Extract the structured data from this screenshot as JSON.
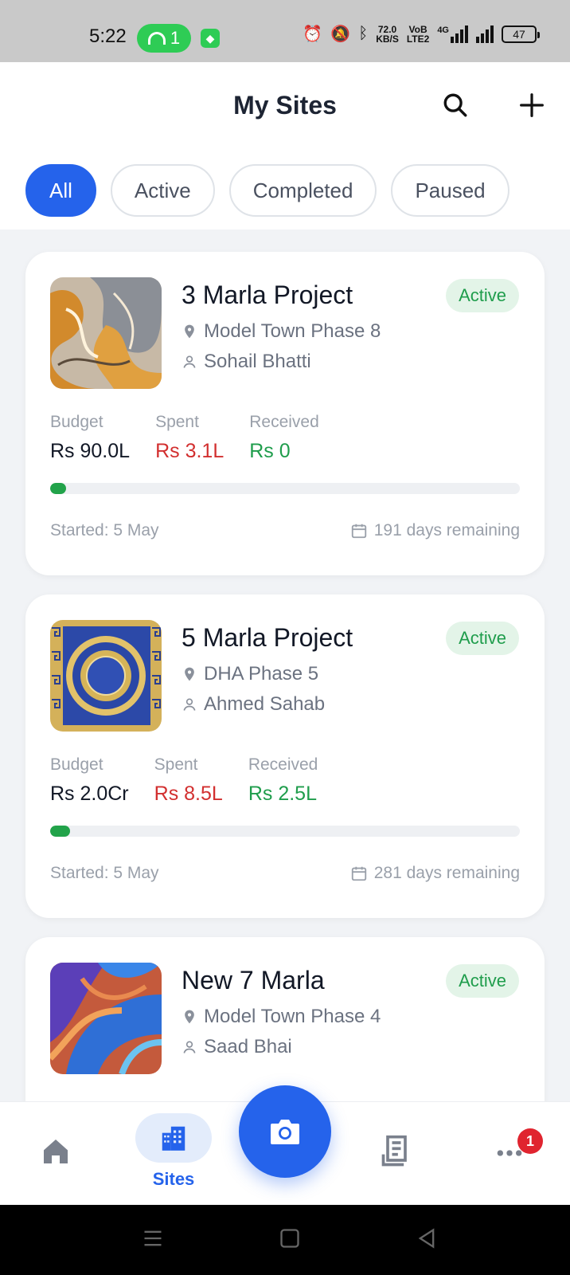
{
  "status_bar": {
    "time": "5:22",
    "hotspot_count": "1",
    "net_speed_value": "72.0",
    "net_speed_unit": "KB/S",
    "volte_top": "VoB",
    "volte_bottom": "LTE2",
    "network": "4G",
    "battery": "47"
  },
  "header": {
    "title": "My Sites",
    "search_icon": "search-icon",
    "add_icon": "plus-icon"
  },
  "filters": [
    {
      "label": "All",
      "selected": true
    },
    {
      "label": "Active",
      "selected": false
    },
    {
      "label": "Completed",
      "selected": false
    },
    {
      "label": "Paused",
      "selected": false
    }
  ],
  "stat_labels": {
    "budget": "Budget",
    "spent": "Spent",
    "received": "Received"
  },
  "sites": [
    {
      "name": "3 Marla Project",
      "status": "Active",
      "location": "Model Town Phase 8",
      "contact": "Sohail Bhatti",
      "budget": "Rs 90.0L",
      "spent": "Rs 3.1L",
      "received": "Rs 0",
      "progress": 0.034,
      "started": "Started: 5 May",
      "remaining": "191 days remaining"
    },
    {
      "name": "5 Marla Project",
      "status": "Active",
      "location": "DHA Phase 5",
      "contact": "Ahmed Sahab",
      "budget": "Rs 2.0Cr",
      "spent": "Rs 8.5L",
      "received": "Rs 2.5L",
      "progress": 0.042,
      "started": "Started: 5 May",
      "remaining": "281 days remaining"
    },
    {
      "name": "New 7 Marla",
      "status": "Active",
      "location": "Model Town Phase 4",
      "contact": "Saad Bhai"
    }
  ],
  "bottom_nav": {
    "home_icon": "home-icon",
    "sites_label": "Sites",
    "sites_icon": "buildings-icon",
    "camera_icon": "camera-icon",
    "bills_icon": "receipt-icon",
    "more_icon": "more-dots-icon",
    "more_badge": "1"
  },
  "colors": {
    "accent": "#2563eb",
    "active_badge_bg": "#e3f4e8",
    "active_badge_text": "#1f9d4c",
    "spent": "#d22f2f",
    "received": "#1f9d4c",
    "progress_fill": "#22a34a"
  }
}
